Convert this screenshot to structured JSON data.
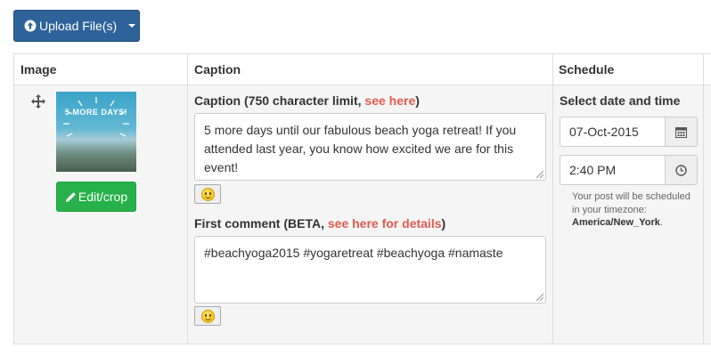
{
  "toolbar": {
    "upload_label": "Upload File(s)",
    "upload_icon": "upload-circle-icon",
    "dropdown_icon": "caret-down-icon",
    "upload_color": "#2e6399"
  },
  "table": {
    "headers": {
      "image": "Image",
      "caption": "Caption",
      "schedule": "Schedule"
    }
  },
  "row": {
    "thumbnail_text": "5 MORE DAYS!",
    "move_icon": "move-arrows-icon",
    "edit_label": "Edit/crop",
    "edit_color": "#27b14a",
    "caption_label": "Caption (750 character limit, ",
    "caption_link": "see here",
    "caption_label_end": ")",
    "caption_text": "5 more days until our fabulous beach yoga retreat! If you attended last year, you know how excited we are for this event!",
    "comment_label": "First comment (BETA, ",
    "comment_link": "see here for details",
    "comment_label_end": ")",
    "comment_text": "#beachyoga2015 #yogaretreat #beachyoga #namaste",
    "link_color": "#e25a4f",
    "schedule_label": "Select date and time",
    "date_value": "07-Oct-2015",
    "time_value": "2:40 PM",
    "help_text": "Your post will be scheduled in your timezone: ",
    "timezone": "America/New_York",
    "help_end": "."
  }
}
